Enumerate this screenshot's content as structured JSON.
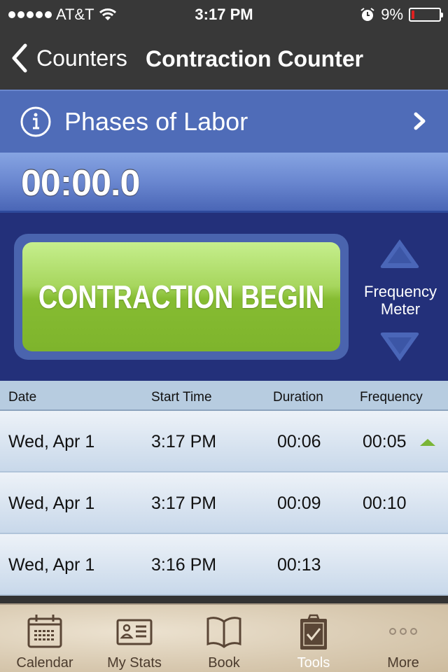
{
  "status_bar": {
    "carrier": "AT&T",
    "signal_bars": 5,
    "time": "3:17 PM",
    "battery_percent_label": "9%",
    "battery_level": 0.09
  },
  "nav": {
    "back_label": "Counters",
    "title": "Contraction Counter"
  },
  "phases": {
    "label": "Phases of Labor"
  },
  "timer": {
    "value": "00:00.0"
  },
  "controls": {
    "begin_label": "CONTRACTION BEGIN",
    "frequency_meter_label_line1": "Frequency",
    "frequency_meter_label_line2": "Meter"
  },
  "table": {
    "headers": [
      "Date",
      "Start Time",
      "Duration",
      "Frequency"
    ],
    "rows": [
      {
        "date": "Wed, Apr 1",
        "start": "3:17 PM",
        "duration": "00:06",
        "frequency": "00:05",
        "trend": "up"
      },
      {
        "date": "Wed, Apr 1",
        "start": "3:17 PM",
        "duration": "00:09",
        "frequency": "00:10",
        "trend": ""
      },
      {
        "date": "Wed, Apr 1",
        "start": "3:16 PM",
        "duration": "00:13",
        "frequency": "",
        "trend": ""
      }
    ]
  },
  "colors": {
    "trend_up": "#7ab536",
    "begin_button": "#86bc32",
    "panel": "#23307a",
    "phases_bar": "#4f6cb8"
  },
  "tab_bar": {
    "tabs": [
      {
        "label": "Calendar",
        "icon": "calendar-icon",
        "active": false
      },
      {
        "label": "My Stats",
        "icon": "id-card-icon",
        "active": false
      },
      {
        "label": "Book",
        "icon": "book-icon",
        "active": false
      },
      {
        "label": "Tools",
        "icon": "clipboard-check-icon",
        "active": true
      },
      {
        "label": "More",
        "icon": "more-dots-icon",
        "active": false
      }
    ]
  }
}
